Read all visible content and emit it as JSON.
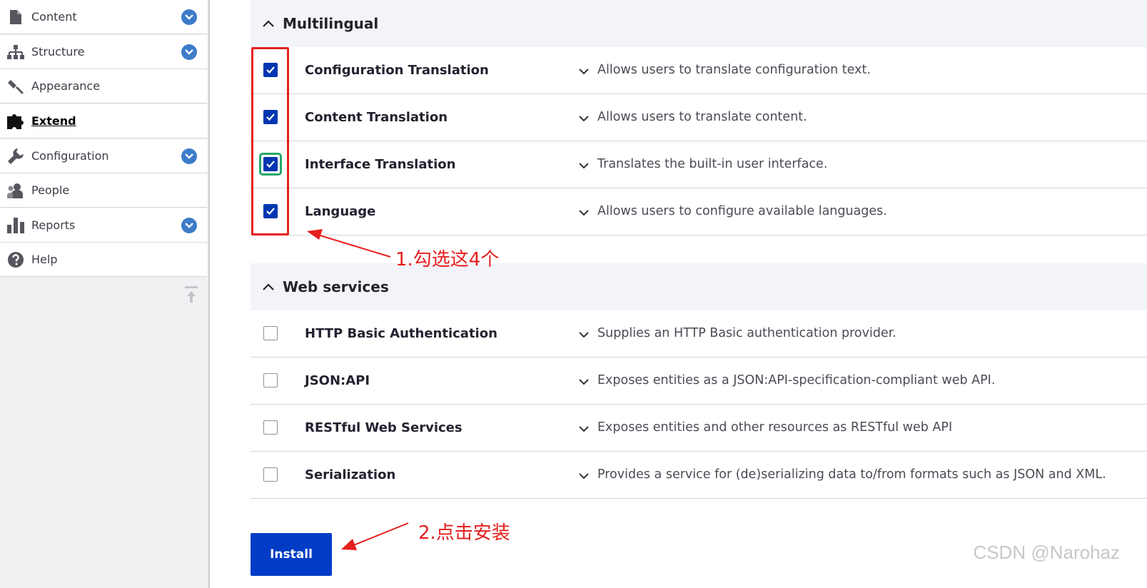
{
  "sidebar": {
    "items": [
      {
        "label": "Content",
        "icon": "file-icon",
        "has_toggle": true
      },
      {
        "label": "Structure",
        "icon": "sitemap-icon",
        "has_toggle": true
      },
      {
        "label": "Appearance",
        "icon": "paintbrush-icon",
        "has_toggle": false
      },
      {
        "label": "Extend",
        "icon": "puzzle-icon",
        "has_toggle": false,
        "active": true
      },
      {
        "label": "Configuration",
        "icon": "wrench-icon",
        "has_toggle": true
      },
      {
        "label": "People",
        "icon": "person-icon",
        "has_toggle": false
      },
      {
        "label": "Reports",
        "icon": "bar-chart-icon",
        "has_toggle": true
      },
      {
        "label": "Help",
        "icon": "question-icon",
        "has_toggle": false
      }
    ]
  },
  "groups": [
    {
      "title": "Multilingual",
      "modules": [
        {
          "name": "Configuration Translation",
          "description": "Allows users to translate configuration text.",
          "checked": true
        },
        {
          "name": "Content Translation",
          "description": "Allows users to translate content.",
          "checked": true
        },
        {
          "name": "Interface Translation",
          "description": "Translates the built-in user interface.",
          "checked": true,
          "focused": true
        },
        {
          "name": "Language",
          "description": "Allows users to configure available languages.",
          "checked": true
        }
      ]
    },
    {
      "title": "Web services",
      "modules": [
        {
          "name": "HTTP Basic Authentication",
          "description": "Supplies an HTTP Basic authentication provider.",
          "checked": false
        },
        {
          "name": "JSON:API",
          "description": "Exposes entities as a JSON:API-specification-compliant web API.",
          "checked": false
        },
        {
          "name": "RESTful Web Services",
          "description": "Exposes entities and other resources as RESTful web API",
          "checked": false
        },
        {
          "name": "Serialization",
          "description": "Provides a service for (de)serializing data to/from formats such as JSON and XML.",
          "checked": false
        }
      ]
    }
  ],
  "install_label": "Install",
  "annotations": {
    "step1": "1.勾选这4个",
    "step2": "2.点击安装"
  },
  "watermark": "CSDN @Narohaz",
  "colors": {
    "accent": "#003cc5",
    "checkbox_checked": "#0036b1",
    "annotation_red": "#e61e1e",
    "focus_green": "#26a769",
    "toggle_blue": "#3d7cc9"
  }
}
